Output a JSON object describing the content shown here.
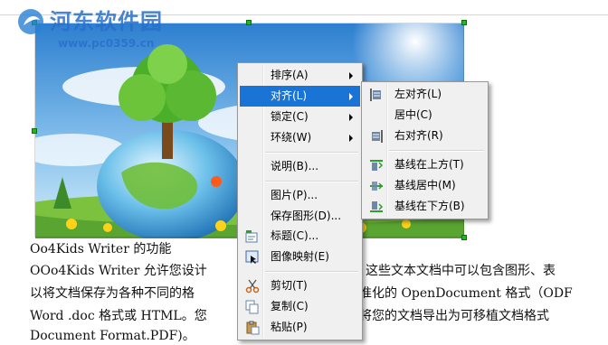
{
  "watermark": {
    "title": "河东软件园",
    "url": "www.pc0359.cn"
  },
  "document": {
    "lines": [
      "Oo4Kids Writer 的功能",
      "OOo4Kids Writer 允许您设计",
      "以将文档保存为各种不同的格",
      "Word .doc 格式或  HTML。您",
      "Document Format.PDF)。"
    ],
    "right_fragments": [
      "这些文本文档中可以包含图形、表",
      "准化的 OpenDocument 格式（ODF",
      "将您的文档导出为可移植文档格式"
    ]
  },
  "context_menu": {
    "items": [
      {
        "label": "排序(A)",
        "submenu": true
      },
      {
        "label": "对齐(L)",
        "submenu": true,
        "highlighted": true
      },
      {
        "label": "锁定(C)",
        "submenu": true
      },
      {
        "label": "环绕(W)",
        "submenu": true
      },
      {
        "label": "说明(B)..."
      },
      {
        "label": "图片(P)..."
      },
      {
        "label": "保存图形(D)..."
      },
      {
        "label": "标题(C)...",
        "icon": "caption-icon"
      },
      {
        "label": "图像映射(E)",
        "icon": "image-map-icon"
      },
      {
        "label": "剪切(T)",
        "icon": "scissors-icon"
      },
      {
        "label": "复制(C)",
        "icon": "copy-icon"
      },
      {
        "label": "粘贴(P)",
        "icon": "paste-icon"
      }
    ]
  },
  "align_submenu": {
    "items": [
      {
        "label": "左对齐(L)",
        "icon": "align-left-icon"
      },
      {
        "label": "居中(C)"
      },
      {
        "label": "右对齐(R)",
        "icon": "align-right-icon"
      },
      {
        "label": "基线在上方(T)",
        "icon": "baseline-top-icon"
      },
      {
        "label": "基线居中(M)",
        "icon": "baseline-center-icon"
      },
      {
        "label": "基线在下方(B)",
        "icon": "baseline-bottom-icon"
      }
    ]
  },
  "colors": {
    "highlight": "#1a74d6",
    "handle": "#1fb81f",
    "watermark": "#286ec8"
  }
}
